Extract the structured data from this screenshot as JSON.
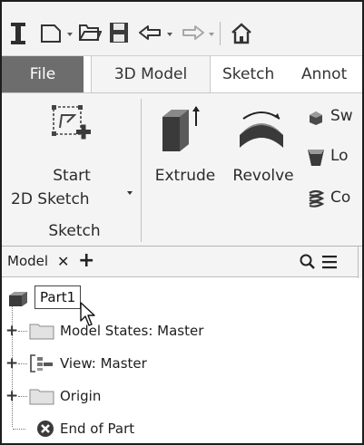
{
  "tabs": [
    {
      "label": "File"
    },
    {
      "label": "3D Model"
    },
    {
      "label": "Sketch"
    },
    {
      "label": "Annot"
    }
  ],
  "ribbon": {
    "start_sketch_line1": "Start",
    "start_sketch_line2": "2D Sketch",
    "extrude_label": "Extrude",
    "revolve_label": "Revolve",
    "sweep_label": "Sw",
    "loft_label": "Lo",
    "coil_label": "Co",
    "sketch_panel_label": "Sketch"
  },
  "browser": {
    "title": "Model",
    "close_glyph": "✕",
    "add_glyph": "+"
  },
  "tree": {
    "root": "Part1",
    "items": [
      {
        "label": "Model States: Master"
      },
      {
        "label": "View: Master"
      },
      {
        "label": "Origin"
      },
      {
        "label": "End of Part"
      }
    ]
  },
  "colors": {
    "file_tab": "#6d6d6d",
    "ribbon_bg": "#f4f4f4",
    "icon_dark": "#3a3a3a"
  }
}
